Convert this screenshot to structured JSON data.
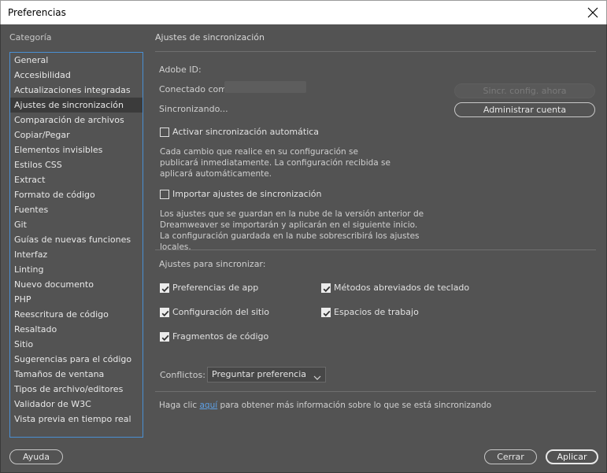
{
  "window": {
    "title": "Preferencias"
  },
  "sidebar": {
    "title": "Categoría",
    "items": [
      "General",
      "Accesibilidad",
      "Actualizaciones integradas",
      "Ajustes de sincronización",
      "Comparación de archivos",
      "Copiar/Pegar",
      "Elementos invisibles",
      "Estilos CSS",
      "Extract",
      "Formato de código",
      "Fuentes",
      "Git",
      "Guías de nuevas funciones",
      "Interfaz",
      "Linting",
      "Nuevo documento",
      "PHP",
      "Reescritura de código",
      "Resaltado",
      "Sitio",
      "Sugerencias para el código",
      "Tamaños de ventana",
      "Tipos de archivo/editores",
      "Validador de W3C",
      "Vista previa en tiempo real"
    ],
    "selected_index": 3
  },
  "main": {
    "section_title": "Ajustes de sincronización",
    "adobe_id_label": "Adobe ID:",
    "connected_label": "Conectado como",
    "syncing_label": "Sincronizando...",
    "sync_now_button": "Sincr. config. ahora",
    "manage_account_button": "Administrar cuenta",
    "auto_sync": {
      "label": "Activar sincronización automática",
      "checked": false
    },
    "auto_sync_desc": "Cada cambio que realice en su configuración se publicará inmediatamente. La configuración recibida se aplicará automáticamente.",
    "import_sync": {
      "label": "Importar ajustes de sincronización",
      "checked": false
    },
    "import_sync_desc": "Los ajustes que se guardan en la nube de la versión anterior de Dreamweaver se importarán y aplicarán en el siguiente inicio. La configuración guardada en la nube sobrescribirá los ajustes locales.",
    "settings_to_sync_label": "Ajustes para sincronizar:",
    "sync_items": [
      {
        "label": "Preferencias de app",
        "checked": true
      },
      {
        "label": "Métodos abreviados de teclado",
        "checked": true
      },
      {
        "label": "Configuración del sitio",
        "checked": true
      },
      {
        "label": "Espacios de trabajo",
        "checked": true
      },
      {
        "label": "Fragmentos de código",
        "checked": true
      }
    ],
    "conflicts_label": "Conflictos:",
    "conflicts_value": "Preguntar preferencia",
    "help_prefix": "Haga clic ",
    "help_link": "aquí",
    "help_suffix": " para obtener más información sobre lo que se está sincronizando"
  },
  "footer": {
    "help_button": "Ayuda",
    "cancel_button": "Cerrar",
    "apply_button": "Aplicar"
  },
  "colors": {
    "background": "#535353",
    "selection": "#3b3b3b",
    "accent": "#4a8fd3",
    "link": "#5ea1e6"
  }
}
